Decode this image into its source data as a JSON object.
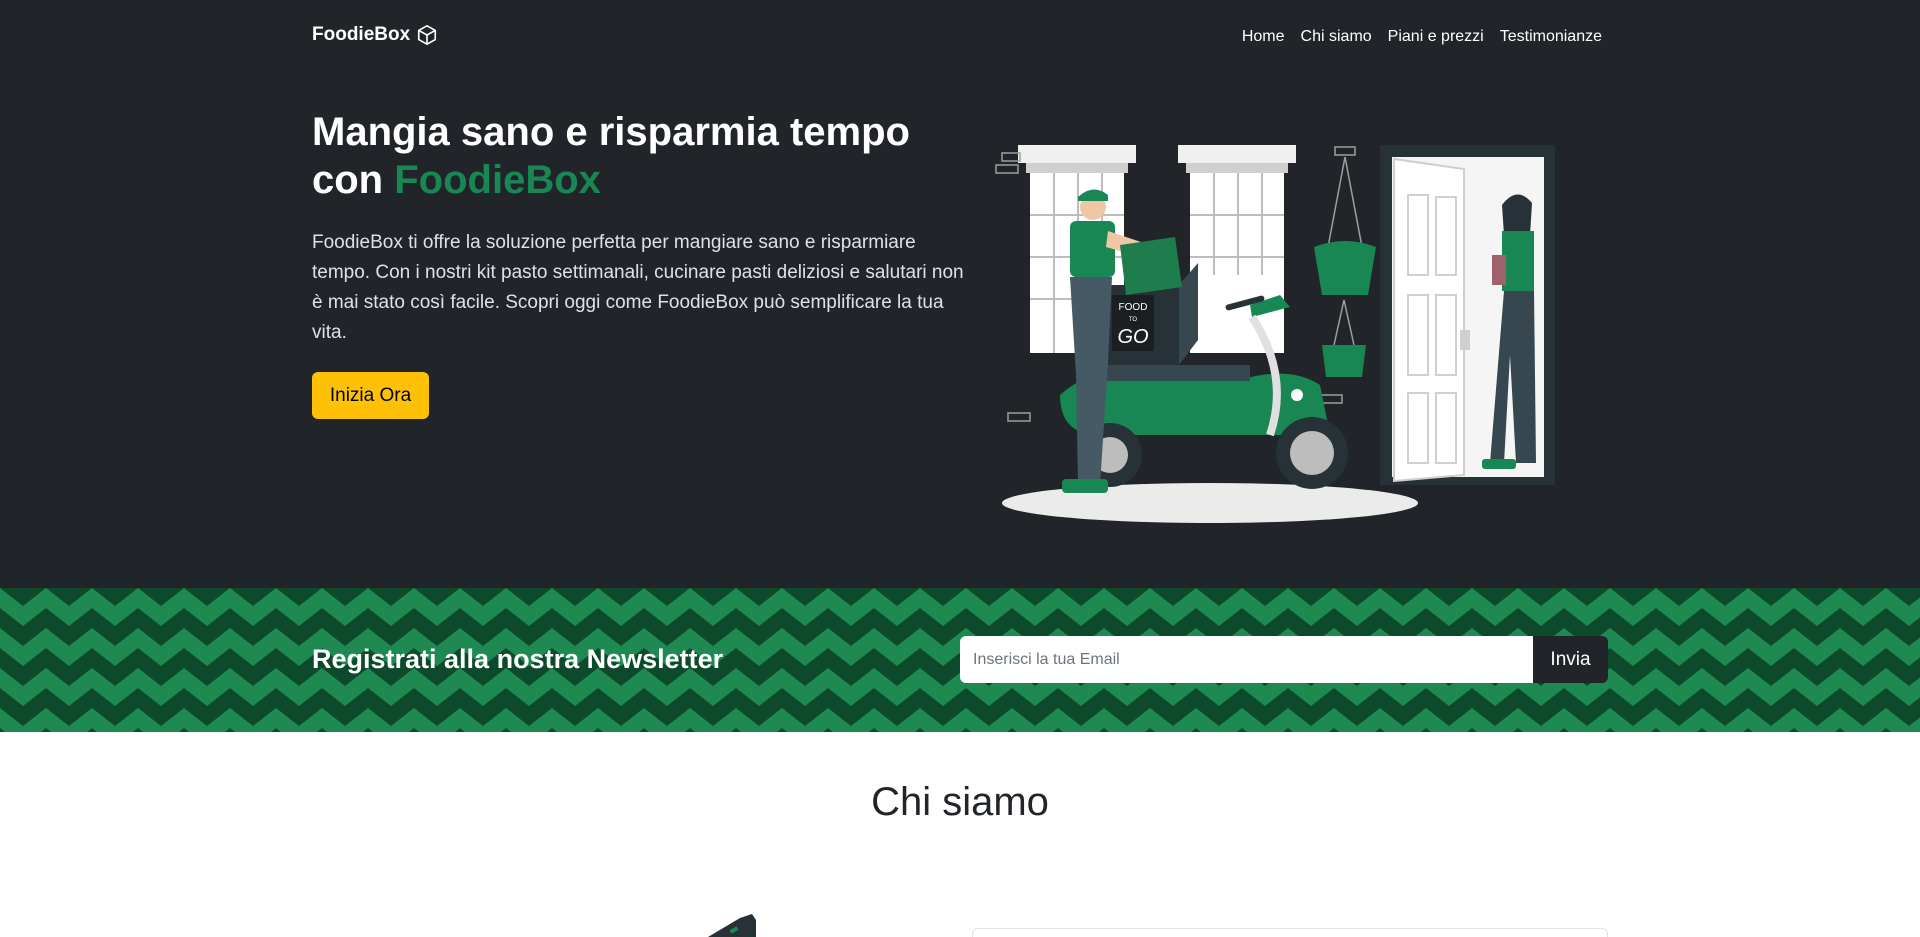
{
  "brand": {
    "name": "FoodieBox",
    "icon": "box-icon"
  },
  "nav": {
    "items": [
      {
        "label": "Home"
      },
      {
        "label": "Chi siamo"
      },
      {
        "label": "Piani e prezzi"
      },
      {
        "label": "Testimonianze"
      }
    ]
  },
  "hero": {
    "title_prefix": "Mangia sano e risparmia tempo con",
    "title_accent": "FoodieBox",
    "description": "FoodieBox ti offre la soluzione perfetta per mangiare sano e risparmiare tempo. Con i nostri kit pasto settimanali, cucinare pasti deliziosi e salutari non è mai stato così facile. Scopri oggi come FoodieBox può semplificare la tua vita.",
    "cta_label": "Inizia Ora",
    "illustration_sign": [
      "FOOD",
      "TO",
      "GO"
    ]
  },
  "newsletter": {
    "title": "Registrati alla nostra Newsletter",
    "email_placeholder": "Inserisci la tua Email",
    "email_value": "",
    "submit_label": "Invia"
  },
  "about": {
    "title": "Chi siamo"
  },
  "colors": {
    "dark_bg": "#212529",
    "accent_green": "#198754",
    "dark_green": "#0d4a2c",
    "cta_yellow": "#ffc107",
    "white": "#ffffff"
  }
}
